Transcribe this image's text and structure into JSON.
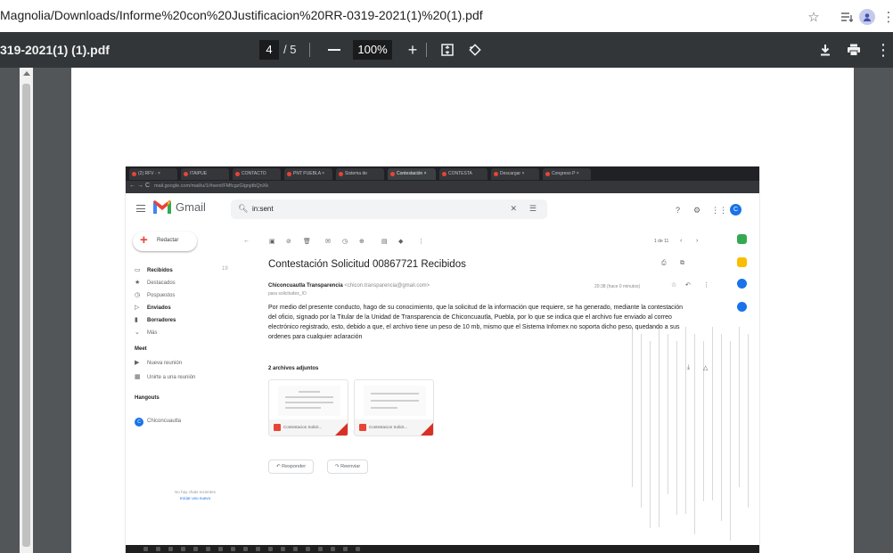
{
  "browser": {
    "url": "Magnolia/Downloads/Informe%20con%20Justificacion%20RR-0319-2021(1)%20(1).pdf",
    "icons": [
      "star-icon",
      "reading-list-icon",
      "profile-icon",
      "menu-icon"
    ]
  },
  "pdf_toolbar": {
    "filename": "319-2021(1) (1).pdf",
    "current_page": "4",
    "total_pages": "/ 5",
    "zoom": "100%",
    "icons": [
      "zoom-out-icon",
      "zoom-in-icon",
      "fit-page-icon",
      "rotate-icon",
      "download-icon",
      "print-icon",
      "more-icon"
    ]
  },
  "embedded_screenshot": {
    "tabs": [
      {
        "label": "(2) RFV · ×"
      },
      {
        "label": "ITAIPUE"
      },
      {
        "label": "CONTACTO"
      },
      {
        "label": "PNT PUEBLA ×"
      },
      {
        "label": "Sistema de"
      },
      {
        "label": "Contestación ×"
      },
      {
        "label": "CONTESTA"
      },
      {
        "label": "Descargar ×"
      },
      {
        "label": "Congreso P ×"
      }
    ],
    "address": "mail.google.com/mail/u/1/#sent/FMfcgzGlgnjdbQnXk",
    "address_host": "mail.google.com",
    "gmail": {
      "app_name": "Gmail",
      "search_query": "in:sent",
      "compose": "Redactar",
      "nav": [
        {
          "label": "Recibidos",
          "count": "19"
        },
        {
          "label": "Destacados"
        },
        {
          "label": "Pospuestos"
        },
        {
          "label": "Enviados"
        },
        {
          "label": "Borradores"
        },
        {
          "label": "Más"
        }
      ],
      "meet_title": "Meet",
      "meet_items": [
        {
          "label": "Nueva reunión"
        },
        {
          "label": "Unirte a una reunión"
        }
      ],
      "hangouts_title": "Hangouts",
      "hangouts_user": "Chiconcuautla",
      "pager": "1 de 11",
      "subject": "Contestación Solicitud 00867721 Recibidos",
      "sender_name": "Chiconcuautla Transparencia",
      "sender_email": "<chicon.transparencia@gmail.com>",
      "to_line": "para solicitudes_IO",
      "date": "20:38 (hace 0 minutos)",
      "body": "Por medio del presente conducto, hago de su conocimiento, que la solicitud de la información que requiere, se ha generado, mediante la contestación del oficio, signado por la Titular de la Unidad de Transparencia de Chiconcuautla, Puebla, por lo que se indica que el archivo fue enviado al correo electrónico registrado, esto, debido a que, el archivo tiene un peso de 10 mb, mismo que el Sistema Infomex no soporta dicho peso, quedando a sus ordenes para cualquier aclaración",
      "attachments_title": "2 archivos adjuntos",
      "attachments": [
        {
          "name": "Contestacion Solicit..."
        },
        {
          "name": "Contestacion Solicit..."
        }
      ],
      "reply": "Responder",
      "forward": "Reenviar",
      "chat_empty": "No hay chats recientes",
      "chat_start": "Iniciar uno nuevo",
      "avatar_letter": "C"
    }
  }
}
